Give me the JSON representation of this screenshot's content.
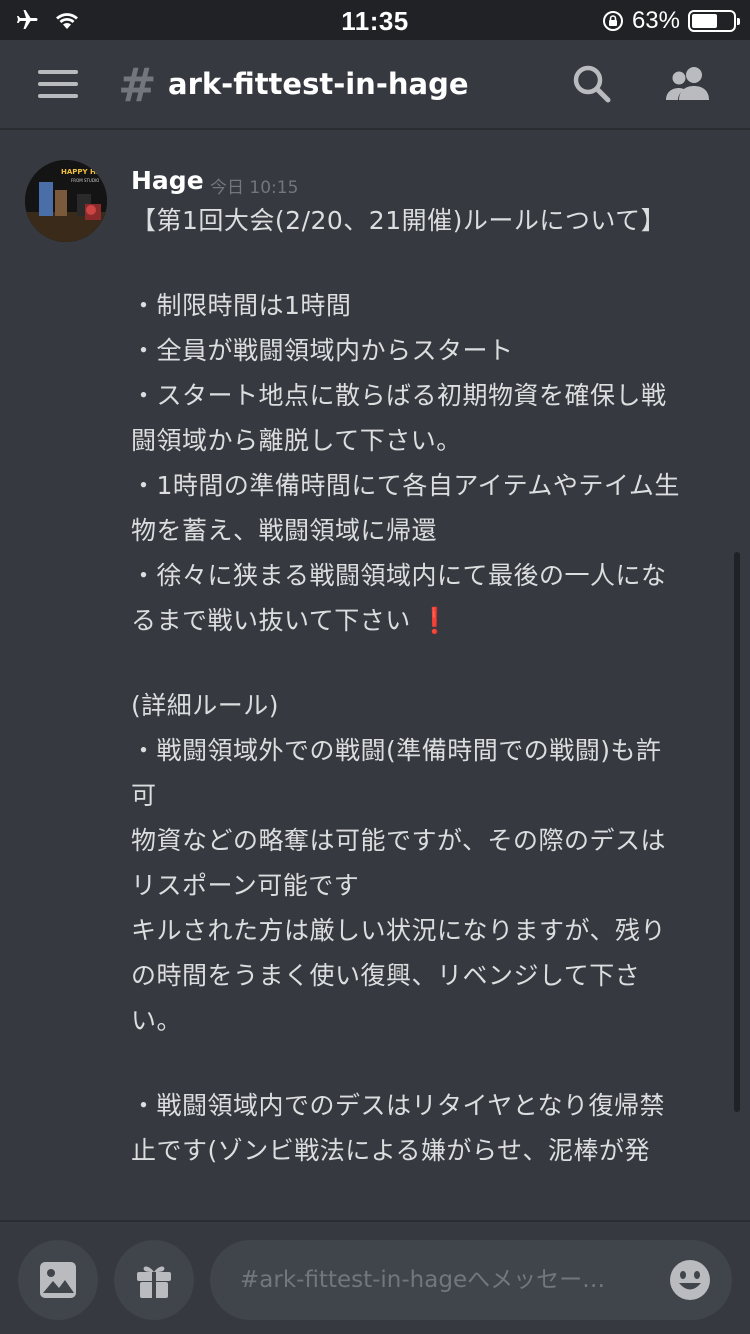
{
  "status_bar": {
    "time": "11:35",
    "battery_percent": "63%",
    "battery_level": 0.63
  },
  "header": {
    "hash_symbol": "#",
    "channel_name": "ark-fittest-in-hage"
  },
  "message": {
    "author": "Hage",
    "timestamp": "今日 10:15",
    "avatar_text": "HAPPY HAGE",
    "avatar_subtext": "FROM STUDIO",
    "lines": [
      "【第1回大会(2/20、21開催)ルールについて】",
      "",
      "・制限時間は1時間",
      "・全員が戦闘領域内からスタート",
      "・スタート地点に散らばる初期物資を確保し戦",
      "闘領域から離脱して下さい。",
      "・1時間の準備時間にて各自アイテムやテイム生",
      "物を蓄え、戦闘領域に帰還",
      "・徐々に狭まる戦闘領域内にて最後の一人にな",
      "るまで戦い抜いて下さい",
      "",
      "(詳細ルール)",
      "・戦闘領域外での戦闘(準備時間での戦闘)も許",
      "可",
      "物資などの略奪は可能ですが、その際のデスは",
      "リスポーン可能です",
      "キルされた方は厳しい状況になりますが、残り",
      "の時間をうまく使い復興、リベンジして下さ",
      "い。",
      "",
      "・戦闘領域内でのデスはリタイヤとなり復帰禁",
      "止です(ゾンビ戦法による嫌がらせ、泥棒が発"
    ],
    "exclamation": "❗"
  },
  "input": {
    "placeholder": "#ark-fittest-in-hageへメッセー…"
  },
  "icons": {
    "menu": "hamburger-menu-icon",
    "search": "search-icon",
    "members": "members-icon",
    "image": "image-icon",
    "gift": "gift-icon",
    "emoji": "emoji-icon"
  },
  "colors": {
    "background": "#36393f",
    "status_bar": "#202225",
    "input": "#40444b",
    "exclaim": "#dd2e44"
  }
}
